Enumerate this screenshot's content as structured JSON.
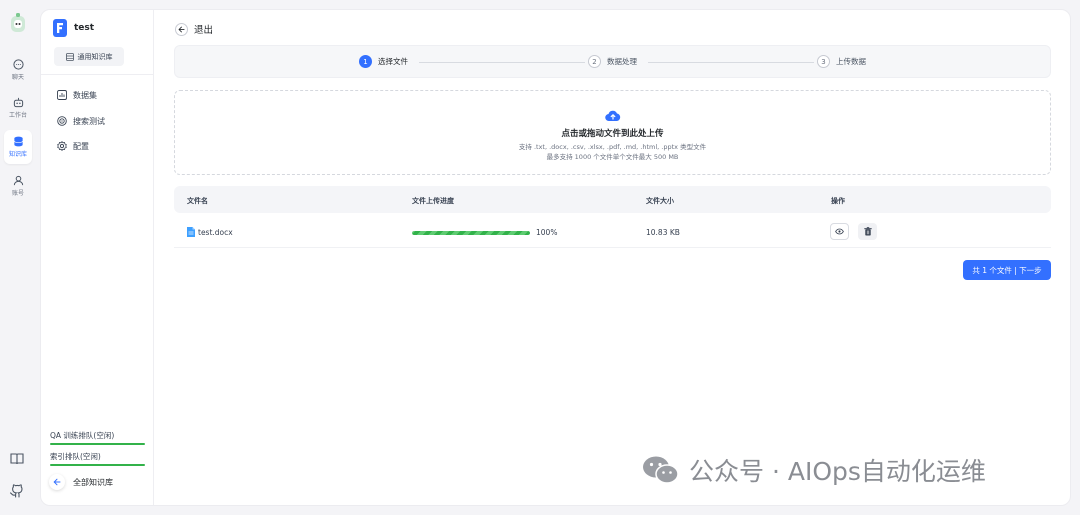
{
  "rail": {
    "items": [
      {
        "label": "聊天",
        "icon": "chat-icon"
      },
      {
        "label": "工作台",
        "icon": "robot-icon"
      },
      {
        "label": "知识库",
        "icon": "database-icon"
      },
      {
        "label": "账号",
        "icon": "user-icon"
      }
    ],
    "active": "知识库",
    "bottom_icons": [
      "book-icon",
      "github-icon"
    ]
  },
  "sidebar": {
    "kb_name": "test",
    "kb_type": "通用知识库",
    "nav": [
      {
        "label": "数据集",
        "icon": "chart-icon"
      },
      {
        "label": "搜索测试",
        "icon": "target-icon"
      },
      {
        "label": "配置",
        "icon": "gear-icon"
      }
    ],
    "queues": [
      "QA 训练排队(空闲)",
      "索引排队(空闲)"
    ],
    "all_kb": "全部知识库"
  },
  "main": {
    "exit_label": "退出",
    "steps": [
      {
        "num": "1",
        "label": "选择文件",
        "active": true
      },
      {
        "num": "2",
        "label": "数据处理",
        "active": false
      },
      {
        "num": "3",
        "label": "上传数据",
        "active": false
      }
    ],
    "drop": {
      "title": "点击或拖动文件到此处上传",
      "formats": "支持 .txt, .docx, .csv, .xlsx, .pdf, .md, .html, .pptx 类型文件",
      "limit": "最多支持 1000 个文件单个文件最大 500 MB"
    },
    "table": {
      "headers": [
        "文件名",
        "文件上传进度",
        "文件大小",
        "操作"
      ],
      "rows": [
        {
          "name": "test.docx",
          "progress_text": "100%",
          "progress": 1.0,
          "size": "10.83 KB"
        }
      ]
    },
    "next_button": "共 1 个文件 | 下一步"
  },
  "watermark": "公众号 · AIOps自动化运维",
  "colors": {
    "accent": "#3370ff",
    "progress": "#32b24a"
  }
}
